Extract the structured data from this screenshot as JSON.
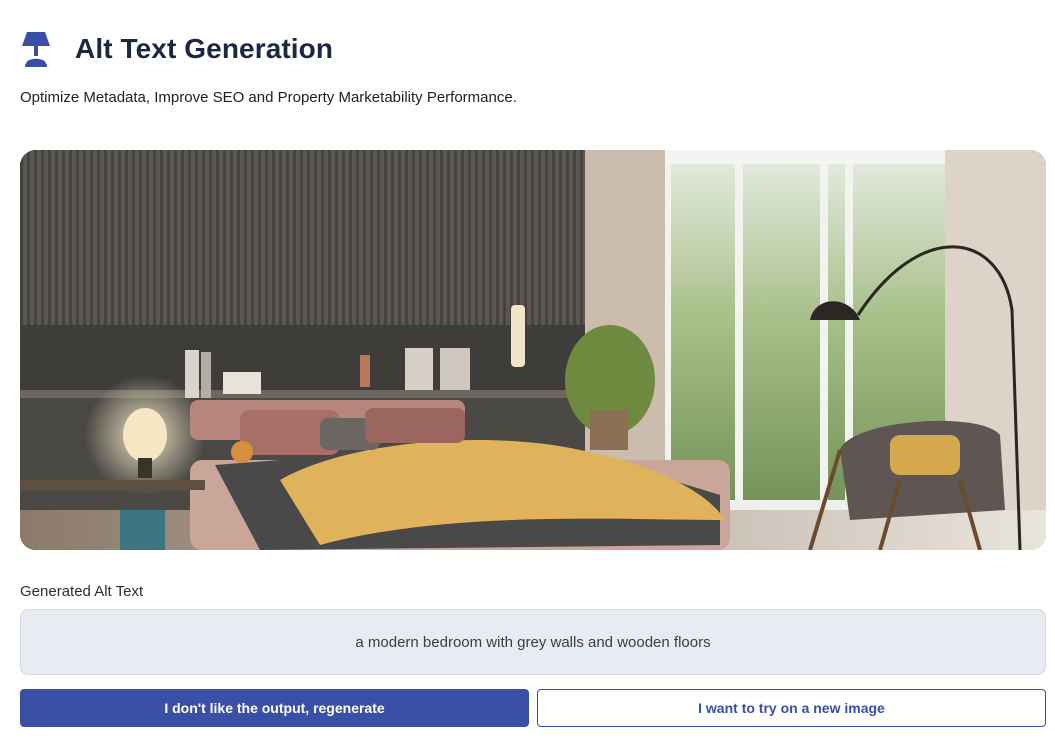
{
  "header": {
    "title": "Alt Text Generation",
    "icon": "lamp-icon",
    "subtitle": "Optimize Metadata, Improve SEO and Property Marketability Performance."
  },
  "image": {
    "description_icon": "bedroom-photo"
  },
  "result": {
    "label": "Generated Alt Text",
    "value": "a modern bedroom with grey walls and wooden floors"
  },
  "actions": {
    "regenerate_label": "I don't like the output, regenerate",
    "new_image_label": "I want to try on a new image"
  },
  "colors": {
    "accent": "#3a4fa6",
    "title": "#1d2742",
    "result_bg": "#e9ebf2"
  }
}
